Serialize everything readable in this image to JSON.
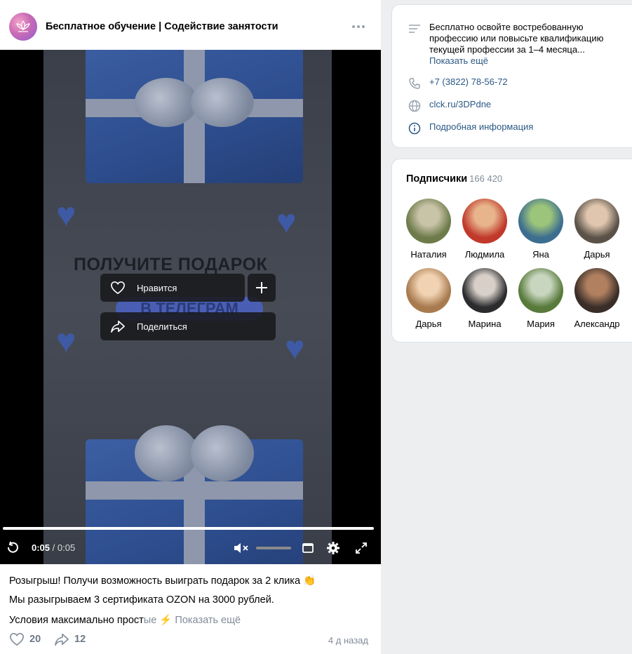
{
  "post": {
    "group_name": "Бесплатное обучение | Содействие занятости",
    "video": {
      "promo_title": "ПОЛУЧИТЕ ПОДАРОК",
      "promo_sub": "В ТЕЛЕГРАМ",
      "like_label": "Нравится",
      "share_label": "Поделиться",
      "time_current": "0:05",
      "time_separator": "/",
      "time_total": "0:05",
      "progress": 1.0
    },
    "text_lines": [
      "Розыгрыш! Получи возможность выиграть подарок за 2 клика 👏",
      "Мы разыгрываем 3 сертификата OZON на 3000 рублей."
    ],
    "text_line3_visible": "Условия максимально прост",
    "text_line3_fade": "ые ⚡",
    "show_more": "Показать ещё",
    "likes": "20",
    "shares": "12",
    "date": "4 д назад"
  },
  "info": {
    "description": "Бесплатно освойте востребованную профессию или повысьте квалификацию текущей профессии за 1–4 месяца...",
    "show_more": "Показать ещё",
    "phone": "+7 (3822) 78-56-72",
    "website": "clck.ru/3DPdne",
    "details": "Подробная информация"
  },
  "subscribers": {
    "title": "Подписчики",
    "count": "166 420",
    "people": [
      {
        "name": "Наталия",
        "c1": "#6d7b4a",
        "c2": "#c9c3a8"
      },
      {
        "name": "Людмила",
        "c1": "#c0392b",
        "c2": "#e8b48c"
      },
      {
        "name": "Яна",
        "c1": "#3d6e8f",
        "c2": "#9cc47a"
      },
      {
        "name": "Дарья",
        "c1": "#5a5248",
        "c2": "#e0c6ae"
      },
      {
        "name": "Дарья",
        "c1": "#a87b4f",
        "c2": "#f1d3b3"
      },
      {
        "name": "Марина",
        "c1": "#2b2b2e",
        "c2": "#d7cfc8"
      },
      {
        "name": "Мария",
        "c1": "#587a3a",
        "c2": "#c8d6c0"
      },
      {
        "name": "Александр",
        "c1": "#3a2e28",
        "c2": "#b08060"
      }
    ]
  },
  "colors": {
    "accent": "#2a5885",
    "muted": "#818c99"
  }
}
